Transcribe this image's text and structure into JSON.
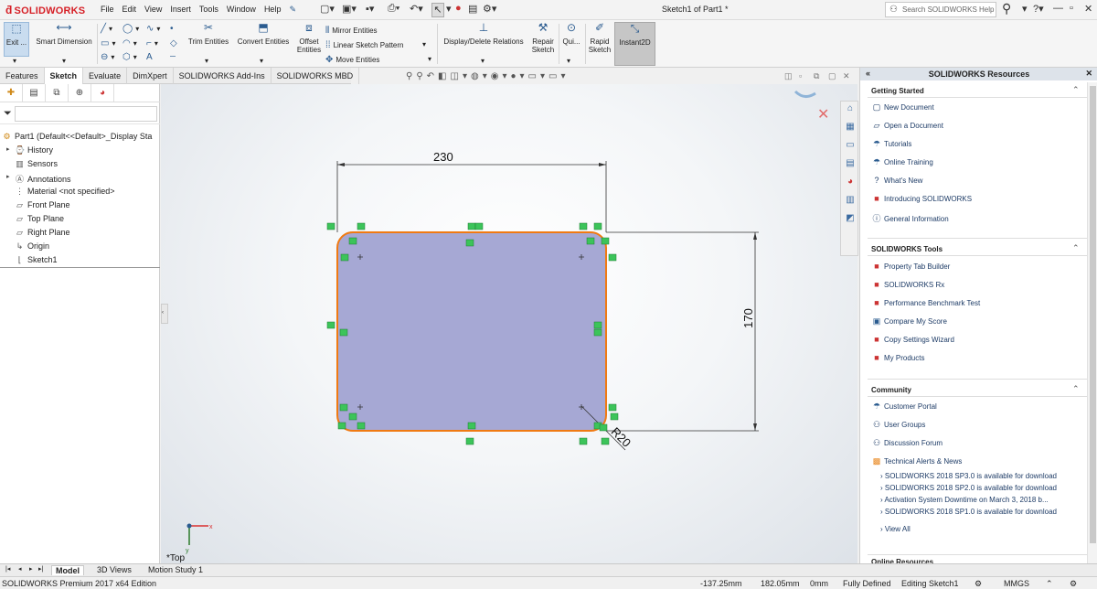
{
  "app": {
    "logo": "SOLIDWORKS",
    "menus": [
      "File",
      "Edit",
      "View",
      "Insert",
      "Tools",
      "Window",
      "Help"
    ],
    "title": "Sketch1 of Part1 *",
    "search_placeholder": "Search SOLIDWORKS Help"
  },
  "toolbar": {
    "exit": "Exit ...",
    "smart_dimension": "Smart Dimension",
    "trim_entities": "Trim Entities",
    "convert_entities": "Convert Entities",
    "offset_entities_1": "Offset",
    "offset_entities_2": "Entities",
    "mirror_entities": "Mirror Entities",
    "linear_sketch_pattern": "Linear Sketch Pattern",
    "move_entities": "Move Entities",
    "display_delete_relations": "Display/Delete Relations",
    "repair_sketch_1": "Repair",
    "repair_sketch_2": "Sketch",
    "quick_snaps": "Qui...",
    "rapid_sketch_1": "Rapid",
    "rapid_sketch_2": "Sketch",
    "instant2d": "Instant2D"
  },
  "tabs": [
    "Features",
    "Sketch",
    "Evaluate",
    "DimXpert",
    "SOLIDWORKS Add-Ins",
    "SOLIDWORKS MBD"
  ],
  "feature_tree": {
    "root": "Part1  (Default<<Default>_Display Sta",
    "items": [
      "History",
      "Sensors",
      "Annotations",
      "Material <not specified>",
      "Front Plane",
      "Top Plane",
      "Right Plane",
      "Origin",
      "Sketch1"
    ]
  },
  "sketch": {
    "dim_width": "230",
    "dim_height": "170",
    "dim_radius": "R20",
    "view_label": "*Top",
    "fill_color": "#a6a8d4",
    "edge_color": "#f07a12"
  },
  "task_pane": {
    "title": "SOLIDWORKS Resources",
    "sections": [
      {
        "title": "Getting Started",
        "items": [
          "New Document",
          "Open a Document",
          "Tutorials",
          "Online Training",
          "What's New",
          "Introducing SOLIDWORKS",
          "General Information"
        ]
      },
      {
        "title": "SOLIDWORKS Tools",
        "items": [
          "Property Tab Builder",
          "SOLIDWORKS Rx",
          "Performance Benchmark Test",
          "Compare My Score",
          "Copy Settings Wizard",
          "My Products"
        ]
      },
      {
        "title": "Community",
        "items": [
          "Customer Portal",
          "User Groups",
          "Discussion Forum",
          "Technical Alerts & News"
        ]
      }
    ],
    "news": [
      "SOLIDWORKS 2018 SP3.0 is available for download",
      "SOLIDWORKS 2018 SP2.0 is available for download",
      "Activation System Downtime on March 3, 2018 b...",
      "SOLIDWORKS 2018 SP1.0 is available for download"
    ],
    "view_all": "View All",
    "online_resources": "Online Resources"
  },
  "bottom_tabs": [
    "Model",
    "3D Views",
    "Motion Study 1"
  ],
  "status": {
    "edition": "SOLIDWORKS Premium 2017 x64 Edition",
    "x": "-137.25mm",
    "y": "182.05mm",
    "z": "0mm",
    "defined": "Fully Defined",
    "editing": "Editing Sketch1",
    "units": "MMGS"
  }
}
